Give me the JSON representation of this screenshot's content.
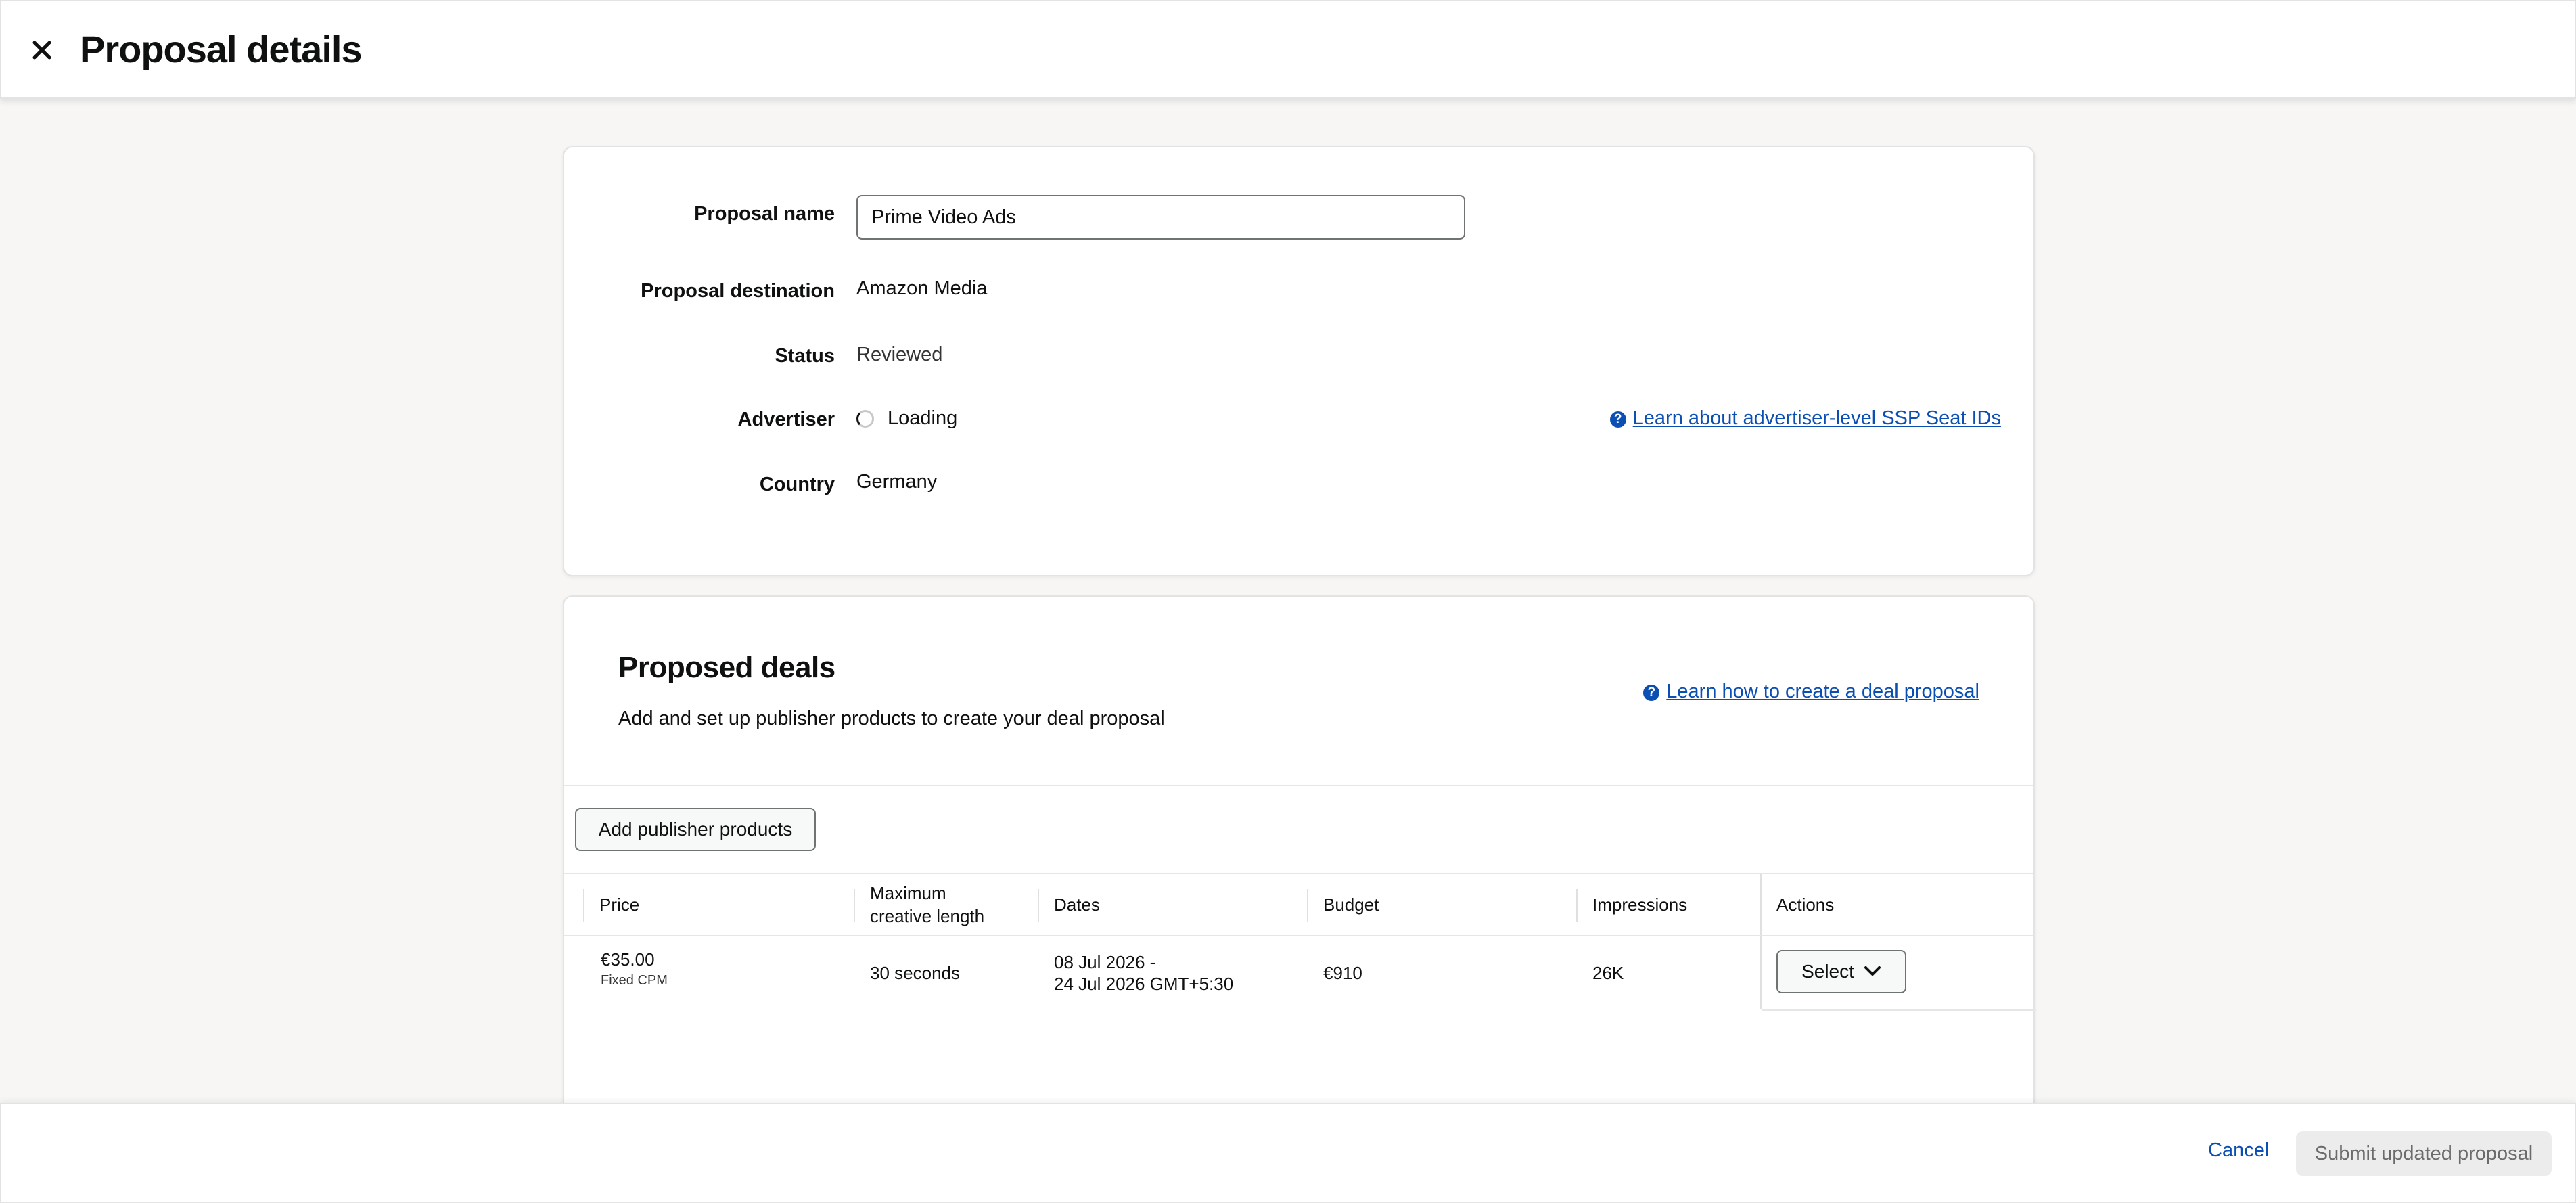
{
  "header": {
    "title": "Proposal details",
    "close_icon": "close-icon"
  },
  "details": {
    "proposal_name_label": "Proposal name",
    "proposal_name_value": "Prime Video Ads",
    "destination_label": "Proposal destination",
    "destination_value": "Amazon Media",
    "status_label": "Status",
    "status_value": "Reviewed",
    "advertiser_label": "Advertiser",
    "advertiser_value": "Loading",
    "advertiser_help_link": "Learn about advertiser-level SSP Seat IDs",
    "country_label": "Country",
    "country_value": "Germany"
  },
  "deals": {
    "title": "Proposed deals",
    "subtitle": "Add and set up publisher products to create your deal proposal",
    "help_link": "Learn how to create a deal proposal",
    "add_button": "Add publisher products",
    "columns": {
      "price": "Price",
      "creative_line1": "Maximum",
      "creative_line2": "creative length",
      "dates": "Dates",
      "budget": "Budget",
      "impressions": "Impressions",
      "actions": "Actions"
    },
    "rows": [
      {
        "price": "€35.00",
        "price_type": "Fixed CPM",
        "creative_length": "30 seconds",
        "date_start": "08 Jul 2026 -",
        "date_end": "24 Jul 2026 GMT+5:30",
        "budget": "€910",
        "impressions": "26K",
        "action_label": "Select"
      }
    ]
  },
  "footer": {
    "cancel_label": "Cancel",
    "submit_label": "Submit updated proposal"
  },
  "colors": {
    "link": "#0b4fb4",
    "page_bg": "#f7f6f4",
    "disabled_button_bg": "#ececec"
  }
}
